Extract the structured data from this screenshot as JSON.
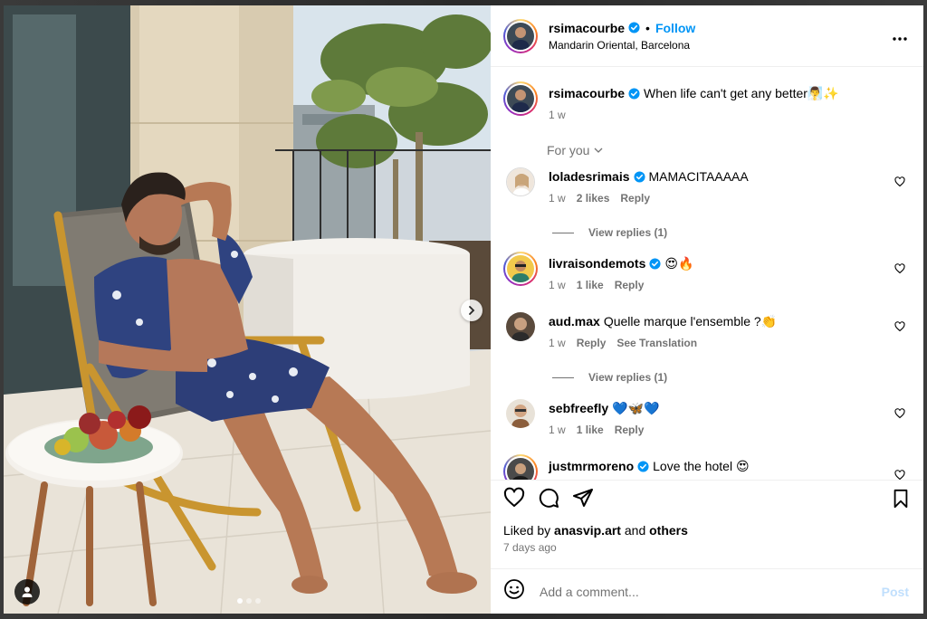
{
  "post": {
    "username": "rsimacourbe",
    "follow_label": "Follow",
    "dot": "•",
    "location": "Mandarin Oriental, Barcelona",
    "caption": "When life can't get any better🧖‍♂️✨",
    "caption_time": "1 w",
    "more_icon": "more-horizontal-icon"
  },
  "for_you": "For you",
  "comments": [
    {
      "username": "loladesrimais",
      "verified": true,
      "text": "MAMACITAAAAA",
      "time": "1 w",
      "likes": "2 likes",
      "reply": "Reply"
    },
    {
      "username": "livraisondemots",
      "verified": true,
      "text": "😍🔥",
      "time": "1 w",
      "likes": "1 like",
      "reply": "Reply"
    },
    {
      "username": "aud.max",
      "verified": false,
      "text": "Quelle marque l'ensemble ?👏",
      "time": "1 w",
      "reply": "Reply",
      "translate": "See Translation"
    },
    {
      "username": "sebfreefly",
      "verified": false,
      "text": "💙🦋💙",
      "time": "1 w",
      "likes": "1 like",
      "reply": "Reply"
    },
    {
      "username": "justmrmoreno",
      "verified": true,
      "text": "Love the hotel 😍"
    }
  ],
  "view_replies": [
    "View replies (1)",
    "View replies (1)"
  ],
  "footer": {
    "liked_prefix": "Liked by",
    "liked_user": "anasvip.art",
    "liked_and": "and",
    "liked_others": "others",
    "date": "7 days ago"
  },
  "comment_box": {
    "placeholder": "Add a comment...",
    "post_label": "Post"
  },
  "colors": {
    "accent": "#0095f6",
    "verified": "#0095f6",
    "muted": "#737373"
  }
}
